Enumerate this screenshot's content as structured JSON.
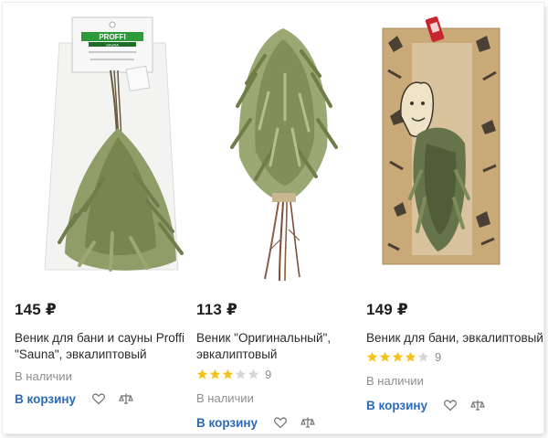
{
  "products": [
    {
      "price": "145 ₽",
      "title_lines": [
        "Веник для бани и сауны Proffi",
        "\"Sauna\", эвкалиптовый"
      ],
      "stock": "В наличии",
      "cart_label": "В корзину",
      "package_brand": "PROFFI",
      "package_sub": "SAUNA"
    },
    {
      "price": "113 ₽",
      "title_lines": [
        "Веник \"Оригинальный\",",
        "эвкалиптовый"
      ],
      "rating": 3,
      "rating_count": "9",
      "stock": "В наличии",
      "cart_label": "В корзину"
    },
    {
      "price": "149 ₽",
      "title_lines": [
        "Веник для бани, эвкалиптовый"
      ],
      "rating": 4,
      "rating_count": "9",
      "stock": "В наличии",
      "cart_label": "В корзину"
    }
  ],
  "colors": {
    "link": "#2a6ab8",
    "star_filled": "#f5c21b",
    "star_empty": "#d6d6d6",
    "leaf": "#8a9a66"
  },
  "icons": [
    "heart-icon",
    "compare-icon",
    "star-icon"
  ]
}
